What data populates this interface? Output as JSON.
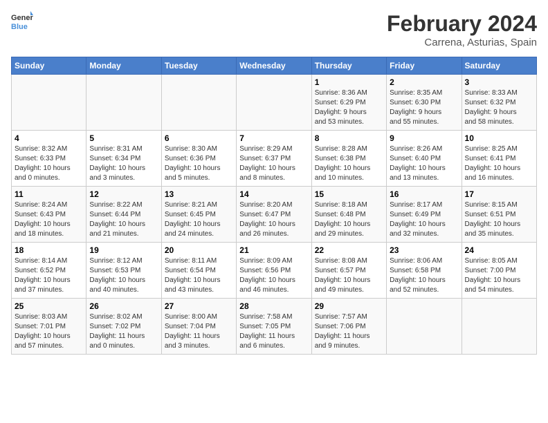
{
  "logo": {
    "text_general": "General",
    "text_blue": "Blue"
  },
  "title": "February 2024",
  "subtitle": "Carrena, Asturias, Spain",
  "days_of_week": [
    "Sunday",
    "Monday",
    "Tuesday",
    "Wednesday",
    "Thursday",
    "Friday",
    "Saturday"
  ],
  "weeks": [
    [
      {
        "day": "",
        "info": ""
      },
      {
        "day": "",
        "info": ""
      },
      {
        "day": "",
        "info": ""
      },
      {
        "day": "",
        "info": ""
      },
      {
        "day": "1",
        "info": "Sunrise: 8:36 AM\nSunset: 6:29 PM\nDaylight: 9 hours\nand 53 minutes."
      },
      {
        "day": "2",
        "info": "Sunrise: 8:35 AM\nSunset: 6:30 PM\nDaylight: 9 hours\nand 55 minutes."
      },
      {
        "day": "3",
        "info": "Sunrise: 8:33 AM\nSunset: 6:32 PM\nDaylight: 9 hours\nand 58 minutes."
      }
    ],
    [
      {
        "day": "4",
        "info": "Sunrise: 8:32 AM\nSunset: 6:33 PM\nDaylight: 10 hours\nand 0 minutes."
      },
      {
        "day": "5",
        "info": "Sunrise: 8:31 AM\nSunset: 6:34 PM\nDaylight: 10 hours\nand 3 minutes."
      },
      {
        "day": "6",
        "info": "Sunrise: 8:30 AM\nSunset: 6:36 PM\nDaylight: 10 hours\nand 5 minutes."
      },
      {
        "day": "7",
        "info": "Sunrise: 8:29 AM\nSunset: 6:37 PM\nDaylight: 10 hours\nand 8 minutes."
      },
      {
        "day": "8",
        "info": "Sunrise: 8:28 AM\nSunset: 6:38 PM\nDaylight: 10 hours\nand 10 minutes."
      },
      {
        "day": "9",
        "info": "Sunrise: 8:26 AM\nSunset: 6:40 PM\nDaylight: 10 hours\nand 13 minutes."
      },
      {
        "day": "10",
        "info": "Sunrise: 8:25 AM\nSunset: 6:41 PM\nDaylight: 10 hours\nand 16 minutes."
      }
    ],
    [
      {
        "day": "11",
        "info": "Sunrise: 8:24 AM\nSunset: 6:43 PM\nDaylight: 10 hours\nand 18 minutes."
      },
      {
        "day": "12",
        "info": "Sunrise: 8:22 AM\nSunset: 6:44 PM\nDaylight: 10 hours\nand 21 minutes."
      },
      {
        "day": "13",
        "info": "Sunrise: 8:21 AM\nSunset: 6:45 PM\nDaylight: 10 hours\nand 24 minutes."
      },
      {
        "day": "14",
        "info": "Sunrise: 8:20 AM\nSunset: 6:47 PM\nDaylight: 10 hours\nand 26 minutes."
      },
      {
        "day": "15",
        "info": "Sunrise: 8:18 AM\nSunset: 6:48 PM\nDaylight: 10 hours\nand 29 minutes."
      },
      {
        "day": "16",
        "info": "Sunrise: 8:17 AM\nSunset: 6:49 PM\nDaylight: 10 hours\nand 32 minutes."
      },
      {
        "day": "17",
        "info": "Sunrise: 8:15 AM\nSunset: 6:51 PM\nDaylight: 10 hours\nand 35 minutes."
      }
    ],
    [
      {
        "day": "18",
        "info": "Sunrise: 8:14 AM\nSunset: 6:52 PM\nDaylight: 10 hours\nand 37 minutes."
      },
      {
        "day": "19",
        "info": "Sunrise: 8:12 AM\nSunset: 6:53 PM\nDaylight: 10 hours\nand 40 minutes."
      },
      {
        "day": "20",
        "info": "Sunrise: 8:11 AM\nSunset: 6:54 PM\nDaylight: 10 hours\nand 43 minutes."
      },
      {
        "day": "21",
        "info": "Sunrise: 8:09 AM\nSunset: 6:56 PM\nDaylight: 10 hours\nand 46 minutes."
      },
      {
        "day": "22",
        "info": "Sunrise: 8:08 AM\nSunset: 6:57 PM\nDaylight: 10 hours\nand 49 minutes."
      },
      {
        "day": "23",
        "info": "Sunrise: 8:06 AM\nSunset: 6:58 PM\nDaylight: 10 hours\nand 52 minutes."
      },
      {
        "day": "24",
        "info": "Sunrise: 8:05 AM\nSunset: 7:00 PM\nDaylight: 10 hours\nand 54 minutes."
      }
    ],
    [
      {
        "day": "25",
        "info": "Sunrise: 8:03 AM\nSunset: 7:01 PM\nDaylight: 10 hours\nand 57 minutes."
      },
      {
        "day": "26",
        "info": "Sunrise: 8:02 AM\nSunset: 7:02 PM\nDaylight: 11 hours\nand 0 minutes."
      },
      {
        "day": "27",
        "info": "Sunrise: 8:00 AM\nSunset: 7:04 PM\nDaylight: 11 hours\nand 3 minutes."
      },
      {
        "day": "28",
        "info": "Sunrise: 7:58 AM\nSunset: 7:05 PM\nDaylight: 11 hours\nand 6 minutes."
      },
      {
        "day": "29",
        "info": "Sunrise: 7:57 AM\nSunset: 7:06 PM\nDaylight: 11 hours\nand 9 minutes."
      },
      {
        "day": "",
        "info": ""
      },
      {
        "day": "",
        "info": ""
      }
    ]
  ]
}
